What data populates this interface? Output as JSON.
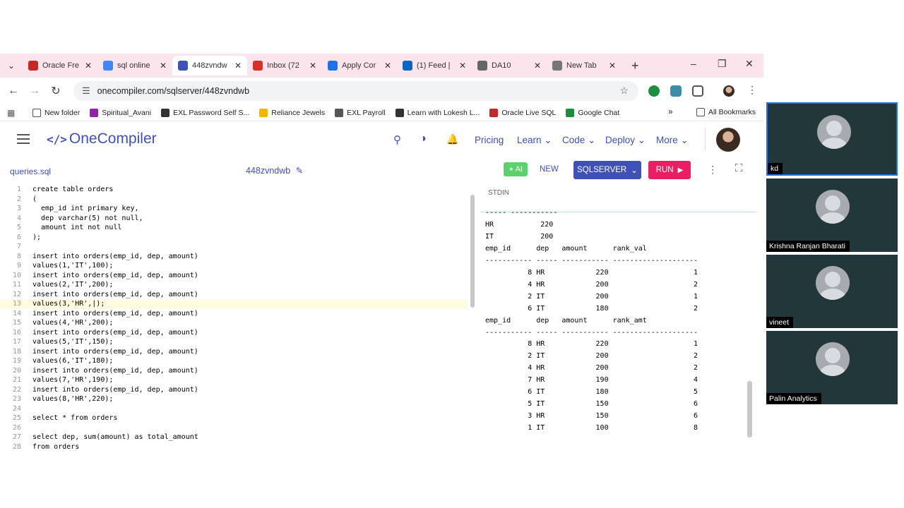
{
  "browser": {
    "tabs": [
      {
        "title": "Oracle Fre",
        "active": false,
        "color": "#c62828"
      },
      {
        "title": "sql online",
        "active": false,
        "color": "#4285f4"
      },
      {
        "title": "448zvndw",
        "active": true,
        "color": "#3f51b5"
      },
      {
        "title": "Inbox (72",
        "active": false,
        "color": "#d93025"
      },
      {
        "title": "Apply Cor",
        "active": false,
        "color": "#1a73e8"
      },
      {
        "title": "(1) Feed |",
        "active": false,
        "color": "#0a66c2"
      },
      {
        "title": "DA10",
        "active": false,
        "color": "#666666"
      },
      {
        "title": "New Tab",
        "active": false,
        "color": "#777777"
      }
    ],
    "url": "onecompiler.com/sqlserver/448zvndwb",
    "bookmarks": [
      "New folder",
      "Spiritual_Avani",
      "EXL Password Self S...",
      "Reliance Jewels",
      "EXL Payroll",
      "Learn with Lokesh L...",
      "Oracle Live SQL",
      "Google Chat"
    ],
    "all_bookmarks": "All Bookmarks",
    "overflow": "»"
  },
  "app": {
    "logo_text": "OneCompiler",
    "logo_mark": "</>",
    "nav": [
      "Pricing",
      "Learn",
      "Code",
      "Deploy",
      "More"
    ]
  },
  "toolbar": {
    "filename": "queries.sql",
    "code_id": "448zvndwb",
    "ai": "AI",
    "new": "NEW",
    "language": "SQLSERVER",
    "run": "RUN"
  },
  "editor": {
    "lines": [
      {
        "n": "1",
        "code": "create table orders"
      },
      {
        "n": "2",
        "code": "("
      },
      {
        "n": "3",
        "code": "  emp_id int primary key,"
      },
      {
        "n": "4",
        "code": "  dep varchar(5) not null,"
      },
      {
        "n": "5",
        "code": "  amount int not null"
      },
      {
        "n": "6",
        "code": ");"
      },
      {
        "n": "7",
        "code": ""
      },
      {
        "n": "8",
        "code": "insert into orders(emp_id, dep, amount)"
      },
      {
        "n": "9",
        "code": "values(1,'IT',100);"
      },
      {
        "n": "10",
        "code": "insert into orders(emp_id, dep, amount)"
      },
      {
        "n": "11",
        "code": "values(2,'IT',200);"
      },
      {
        "n": "12",
        "code": "insert into orders(emp_id, dep, amount)"
      },
      {
        "n": "13",
        "code": "values(3,'HR',|);"
      },
      {
        "n": "14",
        "code": "insert into orders(emp_id, dep, amount)"
      },
      {
        "n": "15",
        "code": "values(4,'HR',200);"
      },
      {
        "n": "16",
        "code": "insert into orders(emp_id, dep, amount)"
      },
      {
        "n": "17",
        "code": "values(5,'IT',150);"
      },
      {
        "n": "18",
        "code": "insert into orders(emp_id, dep, amount)"
      },
      {
        "n": "19",
        "code": "values(6,'IT',180);"
      },
      {
        "n": "20",
        "code": "insert into orders(emp_id, dep, amount)"
      },
      {
        "n": "21",
        "code": "values(7,'HR',190);"
      },
      {
        "n": "22",
        "code": "insert into orders(emp_id, dep, amount)"
      },
      {
        "n": "23",
        "code": "values(8,'HR',220);"
      },
      {
        "n": "24",
        "code": ""
      },
      {
        "n": "25",
        "code": "select * from orders"
      },
      {
        "n": "26",
        "code": ""
      },
      {
        "n": "27",
        "code": "select dep, sum(amount) as total_amount"
      },
      {
        "n": "28",
        "code": "from orders"
      }
    ],
    "highlighted_line": "13"
  },
  "output": {
    "stdin_label": "STDIN",
    "lines": [
      "----- -----------",
      "HR           220",
      "IT           200",
      "emp_id      dep   amount      rank_val",
      "----------- ----- ----------- --------------------",
      "          8 HR            220                    1",
      "          4 HR            200                    2",
      "          2 IT            200                    1",
      "          6 IT            180                    2",
      "emp_id      dep   amount      rank_amt",
      "----------- ----- ----------- --------------------",
      "          8 HR            220                    1",
      "          2 IT            200                    2",
      "          4 HR            200                    2",
      "          7 HR            190                    4",
      "          6 IT            180                    5",
      "          5 IT            150                    6",
      "          3 HR            150                    6",
      "          1 IT            100                    8"
    ]
  },
  "participants": [
    {
      "name": "kd",
      "active": true
    },
    {
      "name": "Krishna Ranjan Bharati",
      "active": false
    },
    {
      "name": "vineet",
      "active": false
    },
    {
      "name": "Palin Analytics",
      "active": false
    }
  ]
}
